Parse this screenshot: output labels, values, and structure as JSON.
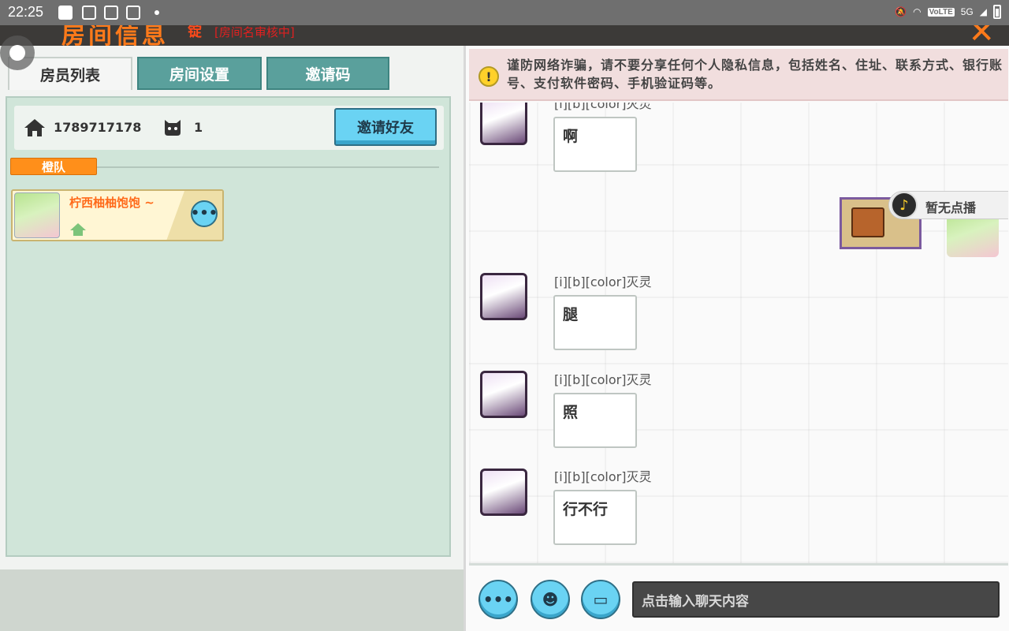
{
  "status_bar": {
    "time": "22:25",
    "network": "5G",
    "volte": "VoLTE"
  },
  "header": {
    "title": "房间信息",
    "tag": "锭",
    "status": "[房间名审核中]"
  },
  "tabs": [
    {
      "label": "房员列表",
      "active": true
    },
    {
      "label": "房间设置",
      "active": false
    },
    {
      "label": "邀请码",
      "active": false
    }
  ],
  "room": {
    "id": "1789717178",
    "member_count": "1",
    "invite_button": "邀请好友"
  },
  "team": {
    "label": "橙队",
    "members": [
      {
        "name": "柠西柚柚饱饱 ~"
      }
    ]
  },
  "warning": {
    "text": "谨防网络诈骗，请不要分享任何个人隐私信息，包括姓名、住址、联系方式、银行账号、支付软件密码、手机验证码等。"
  },
  "chat": {
    "messages": [
      {
        "name": "[i][b][color]灭灵",
        "text": "啊"
      },
      {
        "name": "[i][b][color]灭灵",
        "text": "腿"
      },
      {
        "name": "[i][b][color]灭灵",
        "text": "照"
      },
      {
        "name": "[i][b][color]灭灵",
        "text": "行不行"
      }
    ],
    "music_label": "暂无点播",
    "input_placeholder": "点击输入聊天内容"
  },
  "colors": {
    "accent": "#6ad3f3",
    "team_orange": "#ff8f1a",
    "panel_green": "#d0e5d9",
    "tab_teal": "#5aa09c"
  }
}
